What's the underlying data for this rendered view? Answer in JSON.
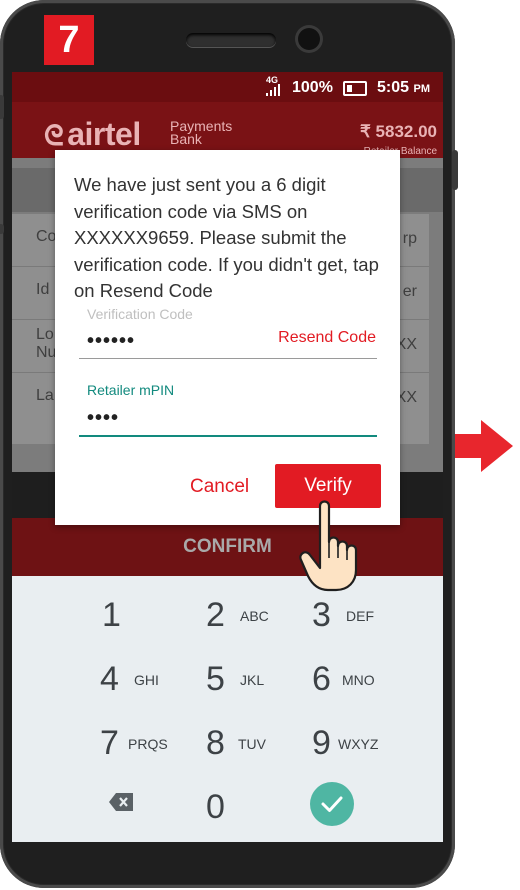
{
  "step_number": "7",
  "status_bar": {
    "network": "4G",
    "battery": "100%",
    "time": "5:05",
    "ampm": "PM"
  },
  "app_header": {
    "brand": "airtel",
    "brand_sub_1": "Payments",
    "brand_sub_2": "Bank",
    "balance": "₹ 5832.00",
    "balance_label": "Retailer Balance"
  },
  "form_rows": [
    {
      "label": "Co",
      "value": "rp"
    },
    {
      "label": "Id",
      "value": "er"
    },
    {
      "label": "Lo\nNu",
      "value": "XX"
    },
    {
      "label": "La",
      "value": "XX"
    }
  ],
  "dialog": {
    "message": "We have just sent you a 6 digit verification code via SMS on XXXXXX9659. Please submit the verification code. If you didn't get, tap on Resend Code",
    "verification_label": "Verification Code",
    "verification_value": "••••••",
    "resend_label": "Resend Code",
    "mpin_label": "Retailer mPIN",
    "mpin_value": "••••",
    "cancel_label": "Cancel",
    "verify_label": "Verify"
  },
  "confirm_label": "CONFIRM",
  "keypad": [
    {
      "num": "1",
      "letters": ""
    },
    {
      "num": "2",
      "letters": "ABC"
    },
    {
      "num": "3",
      "letters": "DEF"
    },
    {
      "num": "4",
      "letters": "GHI"
    },
    {
      "num": "5",
      "letters": "JKL"
    },
    {
      "num": "6",
      "letters": "MNO"
    },
    {
      "num": "7",
      "letters": "PRQS"
    },
    {
      "num": "8",
      "letters": "TUV"
    },
    {
      "num": "9",
      "letters": "WXYZ"
    },
    {
      "num": "0",
      "letters": ""
    }
  ],
  "colors": {
    "accent": "#e21b23",
    "teal": "#128a7e",
    "done_key": "#4fb6a3"
  }
}
